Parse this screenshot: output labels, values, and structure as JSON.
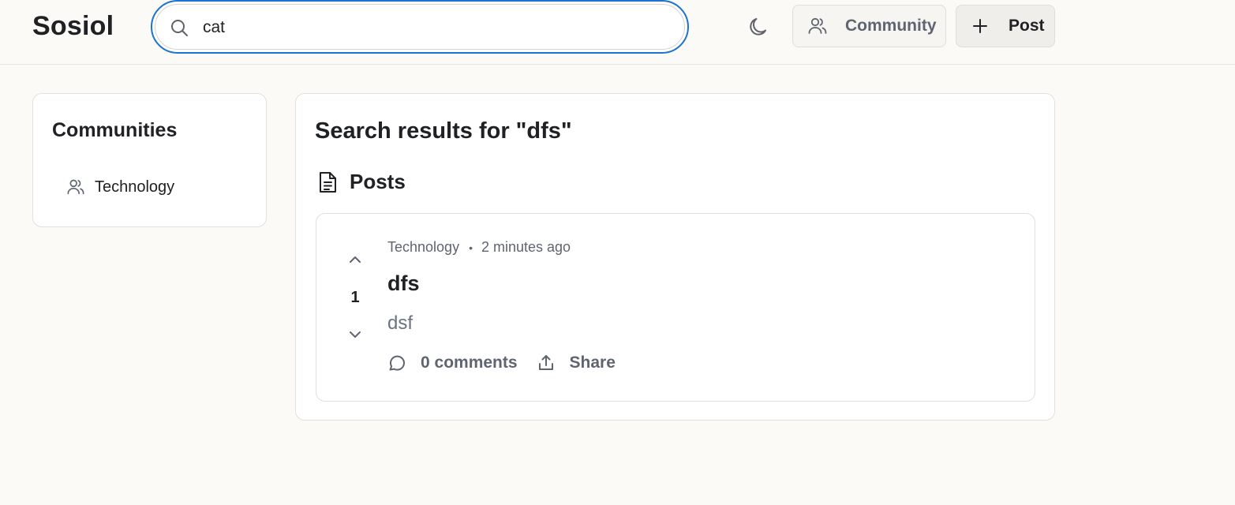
{
  "app": {
    "logo": "Sosiol"
  },
  "header": {
    "search": {
      "value": "cat",
      "placeholder": ""
    },
    "theme_toggle_icon": "moon-icon",
    "community_button": {
      "label": "Community",
      "icon": "users-icon"
    },
    "post_button": {
      "label": "Post",
      "icon": "plus-icon"
    }
  },
  "sidebar": {
    "title": "Communities",
    "items": [
      {
        "label": "Technology",
        "icon": "users-icon"
      }
    ]
  },
  "main": {
    "title": "Search results for \"dfs\"",
    "posts_section": {
      "label": "Posts",
      "icon": "document-icon"
    },
    "posts": [
      {
        "community": "Technology",
        "separator": "•",
        "time": "2 minutes ago",
        "title": "dfs",
        "body": "dsf",
        "votes": "1",
        "comments": "0 comments",
        "share": "Share"
      }
    ]
  },
  "colors": {
    "accent_focus": "#1a73d0",
    "background": "#fbfaf7",
    "card": "#ffffff",
    "muted_text": "#5e6470"
  }
}
